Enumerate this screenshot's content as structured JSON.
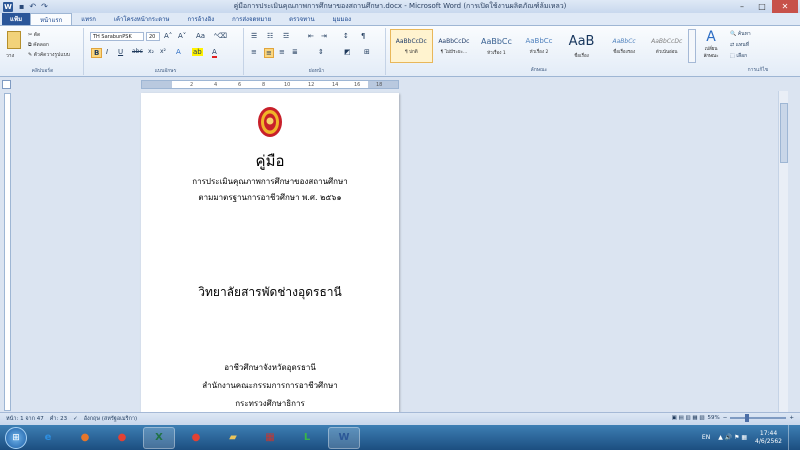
{
  "window": {
    "title": "คู่มือการประเมินคุณภาพการศึกษาของสถานศึกษา.docx - Microsoft Word (การเปิดใช้งานผลิตภัณฑ์ล้มเหลว)",
    "app_icon": "W",
    "minimize": "–",
    "maximize": "□",
    "close": "✕"
  },
  "tabs": [
    "แฟ้ม",
    "หน้าแรก",
    "แทรก",
    "เค้าโครงหน้ากระดาษ",
    "การอ้างอิง",
    "การส่งจดหมาย",
    "ตรวจทาน",
    "มุมมอง"
  ],
  "ribbon": {
    "clipboard": {
      "paste": "วาง",
      "cut": "ตัด",
      "copy": "คัดลอก",
      "format_painter": "ตัวคัดวางรูปแบบ",
      "label": "คลิปบอร์ด"
    },
    "font": {
      "name": "TH SarabunPSK",
      "size": "20",
      "label": "แบบอักษร"
    },
    "paragraph": {
      "label": "ย่อหน้า"
    },
    "styles": {
      "label": "ลักษณะ",
      "items": [
        {
          "preview": "AaBbCcDc",
          "name": "¶ ปกติ"
        },
        {
          "preview": "AaBbCcDc",
          "name": "¶ ไม่มีระยะ..."
        },
        {
          "preview": "AaBbCc",
          "name": "หัวเรื่อง 1"
        },
        {
          "preview": "AaBbCc",
          "name": "หัวเรื่อง 2"
        },
        {
          "preview": "AaB",
          "name": "ชื่อเรื่อง"
        },
        {
          "preview": "AaBbCc",
          "name": "ชื่อเรื่องรอง"
        },
        {
          "preview": "AaBbCcDc",
          "name": "ตัวเน้นอ่อน"
        }
      ],
      "change": "เปลี่ยนลักษณะ"
    },
    "editing": {
      "find": "ค้นหา",
      "replace": "แทนที่",
      "select": "เลือก",
      "label": "การแก้ไข"
    }
  },
  "ruler_numbers": [
    "2",
    "4",
    "6",
    "8",
    "10",
    "12",
    "14",
    "16",
    "18"
  ],
  "document": {
    "heading": "คู่มือ",
    "subtitle_1": "การประเมินคุณภาพการศึกษาของสถานศึกษา",
    "subtitle_2": "ตามมาตรฐานการอาชีวศึกษา พ.ศ. ๒๕๖๑",
    "institution": "วิทยาลัยสารพัดช่างอุดรธานี",
    "footer_1": "อาชีวศึกษาจังหวัดอุดรธานี",
    "footer_2": "สำนักงานคณะกรรมการการอาชีวศึกษา",
    "footer_3": "กระทรวงศึกษาธิการ"
  },
  "status": {
    "page": "หน้า: 1 จาก 47",
    "words": "คำ: 23",
    "language": "อังกฤษ (สหรัฐอเมริกา)",
    "zoom": "59%",
    "zoom_level": 0.59
  },
  "taskbar": {
    "start": "⊞",
    "apps": [
      {
        "name": "internet-explorer",
        "glyph": "e",
        "color": "#2d8ee0",
        "open": false
      },
      {
        "name": "firefox",
        "glyph": "●",
        "color": "#e6762a",
        "open": false
      },
      {
        "name": "chrome",
        "glyph": "●",
        "color": "#e34133",
        "open": false
      },
      {
        "name": "excel",
        "glyph": "X",
        "color": "#1f7244",
        "open": true
      },
      {
        "name": "chrome-2",
        "glyph": "●",
        "color": "#e34133",
        "open": false
      },
      {
        "name": "file-explorer",
        "glyph": "▰",
        "color": "#e9c45b",
        "open": false
      },
      {
        "name": "calendar",
        "glyph": "▦",
        "color": "#c7362f",
        "open": false
      },
      {
        "name": "line",
        "glyph": "L",
        "color": "#38b449",
        "open": false
      },
      {
        "name": "word",
        "glyph": "W",
        "color": "#2b5797",
        "open": true
      }
    ],
    "tray": {
      "lang": "EN",
      "time": "17:44",
      "date": "4/6/2562"
    }
  }
}
